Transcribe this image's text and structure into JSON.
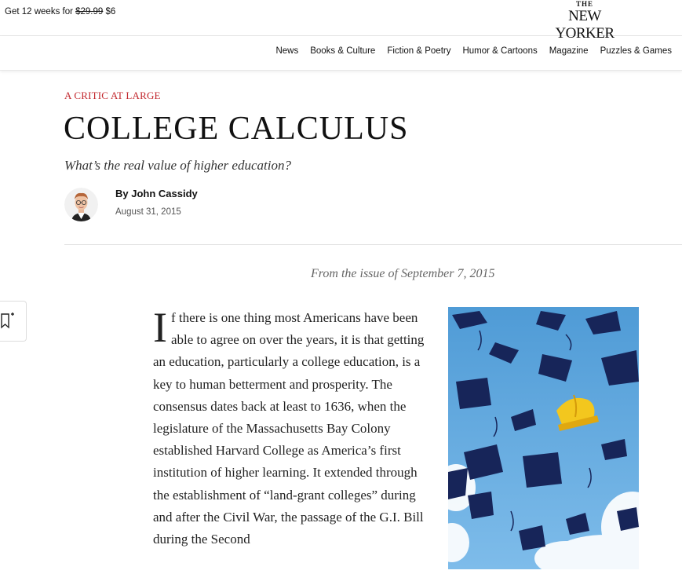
{
  "promo": {
    "text_before": "Get 12 weeks for ",
    "old_price": "$29.99",
    "new_price": " $6"
  },
  "logo": {
    "the": "THE",
    "name": "NEW YORKER"
  },
  "nav": [
    "News",
    "Books & Culture",
    "Fiction & Poetry",
    "Humor & Cartoons",
    "Magazine",
    "Puzzles & Games"
  ],
  "article": {
    "rubric": "A CRITIC AT LARGE",
    "headline": "COLLEGE CALCULUS",
    "dek": "What’s the real value of higher education?",
    "byline": "By John Cassidy",
    "date": "August 31, 2015",
    "issue": "From the issue of September 7, 2015",
    "dropcap": "I",
    "body": "f there is one thing most Americans have been able to agree on over the years, it is that getting an education, particularly a college education, is a key to human betterment and prosperity. The consensus dates back at least to 1636, when the legislature of the Massachusetts Bay Colony established Harvard College as America’s first institution of higher learning. It extended through the establishment of “land-grant colleges” during and after the Civil War, the passage of the G.I. Bill during the Second"
  },
  "icons": {
    "bookmark": "bookmark-add-icon",
    "avatar": "author-avatar"
  },
  "colors": {
    "rubric": "#c2272d",
    "sky": "#5fa9de",
    "cap": "#172559",
    "hardhat": "#f3c71e"
  }
}
